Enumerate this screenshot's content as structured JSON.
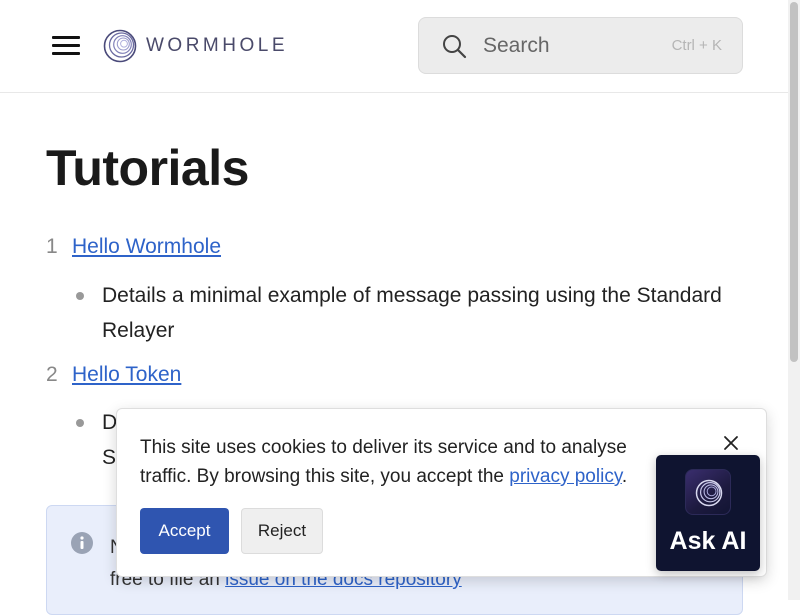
{
  "header": {
    "logo_text": "WORMHOLE",
    "search_placeholder": "Search",
    "search_shortcut": "Ctrl + K"
  },
  "main": {
    "title": "Tutorials",
    "items": [
      {
        "number": "1",
        "link": "Hello Wormhole",
        "description": "Details a minimal example of message passing using the Standard Relayer"
      },
      {
        "number": "2",
        "link": "Hello Token",
        "description": "D                                                                                      S"
      }
    ],
    "note": {
      "line1": "N",
      "line2_prefix": "free to file an ",
      "line2_link": "issue on the docs repository"
    }
  },
  "cookie_banner": {
    "text": "This site uses cookies to deliver its service and to analyse traffic. By browsing this site, you accept the ",
    "link": "privacy policy",
    "suffix": ".",
    "accept_label": "Accept",
    "reject_label": "Reject"
  },
  "ask_ai": {
    "label": "Ask AI"
  },
  "colors": {
    "link": "#2e63c9",
    "accept_button": "#2f55b0",
    "ask_ai_bg": "#0f1430",
    "note_bg": "#e9eefb"
  }
}
